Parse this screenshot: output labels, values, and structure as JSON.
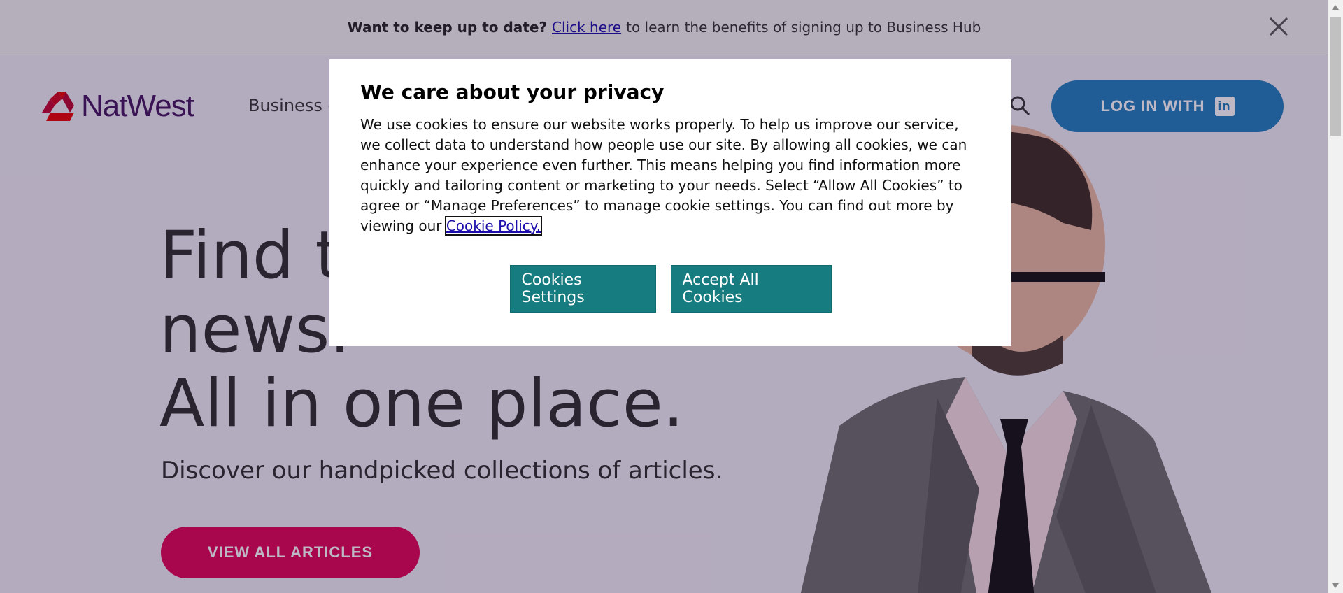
{
  "banner": {
    "lead": "Want to keep up to date?",
    "link": "Click here",
    "rest": "to learn the benefits of signing up to Business Hub",
    "close_icon": "close-icon"
  },
  "header": {
    "logo_text": "NatWest",
    "nav_item": "Business g",
    "search_icon": "search-icon",
    "login_label": "LOG IN WITH",
    "login_icon": "in"
  },
  "hero": {
    "line1": "Find t",
    "line2": "news.",
    "line3": "All in one place.",
    "subtitle": "Discover our handpicked collections of articles.",
    "cta": "VIEW ALL ARTICLES"
  },
  "cookie_modal": {
    "title": "We care about your privacy",
    "body": "We use cookies to ensure our website works properly. To help us improve our service, we collect data to understand how people use our site. By allowing all cookies, we can enhance your experience even further. This means helping you find information more quickly and tailoring content or marketing to your needs. Select “Allow All Cookies” to agree or “Manage Preferences” to manage cookie settings. You can find out more by viewing our ",
    "policy_link": "Cookie Policy.",
    "settings_button": "Cookies Settings",
    "accept_button": "Accept All Cookies"
  },
  "colors": {
    "brand_purple": "#42145f",
    "brand_red": "#e90000",
    "login_blue": "#1d7bbd",
    "cta_pink": "#e00055",
    "modal_button_teal": "#167c80"
  }
}
